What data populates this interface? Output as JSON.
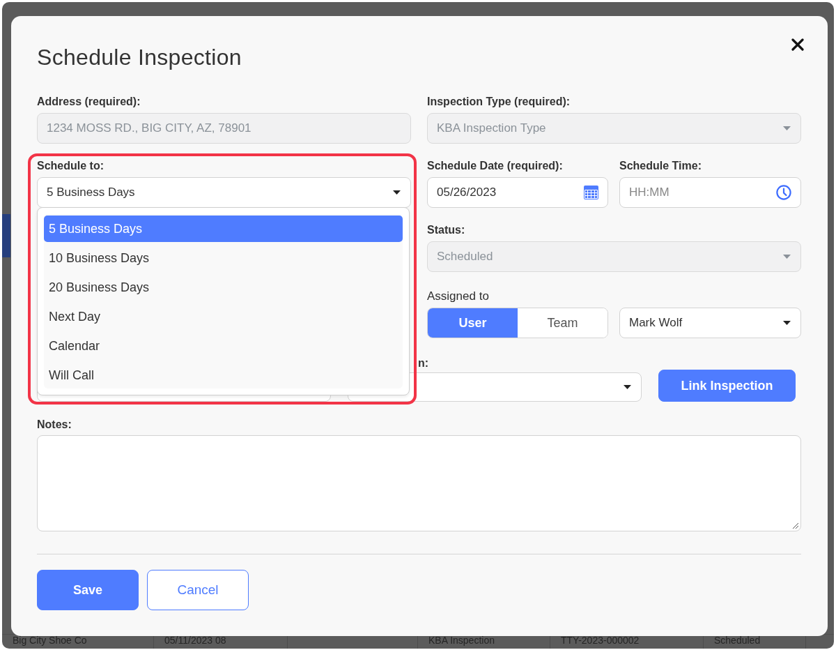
{
  "dialog": {
    "title": "Schedule Inspection"
  },
  "address": {
    "label": "Address (required):",
    "value": "1234 MOSS RD., BIG CITY, AZ, 78901",
    "disabled": true
  },
  "inspection_type": {
    "label": "Inspection Type (required):",
    "value": "KBA Inspection Type",
    "disabled": true
  },
  "schedule_to": {
    "label": "Schedule to:",
    "value": "5 Business Days",
    "expanded": true,
    "highlighted": true,
    "options": [
      {
        "label": "5 Business Days",
        "selected": true
      },
      {
        "label": "10 Business Days",
        "selected": false
      },
      {
        "label": "20 Business Days",
        "selected": false
      },
      {
        "label": "Next Day",
        "selected": false
      },
      {
        "label": "Calendar",
        "selected": false
      },
      {
        "label": "Will Call",
        "selected": false
      }
    ]
  },
  "schedule_date": {
    "label": "Schedule Date (required):",
    "value": "05/26/2023"
  },
  "schedule_time": {
    "label": "Schedule Time:",
    "placeholder": "HH:MM"
  },
  "status": {
    "label": "Status:",
    "value": "Scheduled",
    "disabled": true
  },
  "assigned_to": {
    "label": "Assigned to",
    "modes": [
      {
        "label": "User",
        "selected": true
      },
      {
        "label": "Team",
        "selected": false
      }
    ],
    "value": "Mark Wolf"
  },
  "link_row": {
    "label": "n:",
    "button": "Link Inspection"
  },
  "notes": {
    "label": "Notes:"
  },
  "buttons": [
    {
      "label": "Save",
      "kind": "primary"
    },
    {
      "label": "Cancel",
      "kind": "secondary"
    }
  ],
  "background_table": {
    "cells": [
      "Big City Shoe Co",
      "05/11/2023 08",
      "KBA Inspection",
      "TTY-2023-000002",
      "Scheduled"
    ]
  }
}
